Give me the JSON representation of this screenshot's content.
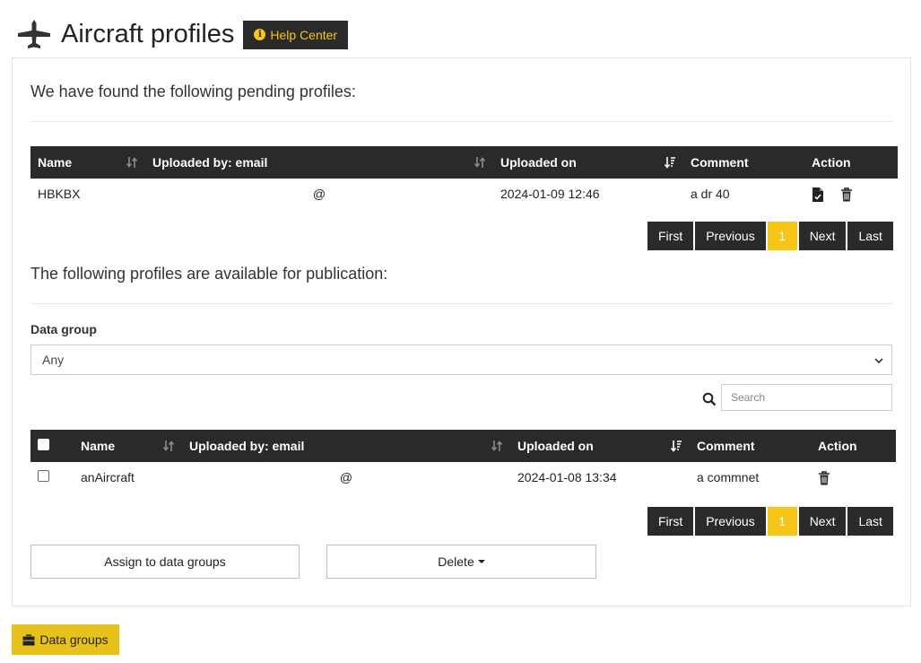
{
  "header": {
    "title": "Aircraft profiles",
    "help_label": "Help Center",
    "plane_icon": "plane-icon",
    "info_icon_glyph": "i"
  },
  "pending": {
    "intro": "We have found the following pending profiles:",
    "columns": [
      "Name",
      "Uploaded by: email",
      "Uploaded on",
      "Comment",
      "Action"
    ],
    "rows": [
      {
        "name": "HBKBX",
        "email": "@",
        "uploaded_on": "2024-01-09 12:46",
        "comment": "a dr 40"
      }
    ],
    "pager": {
      "first": "First",
      "previous": "Previous",
      "page": "1",
      "next": "Next",
      "last": "Last"
    }
  },
  "available": {
    "intro": "The following profiles are available for publication:",
    "data_group_label": "Data group",
    "data_group_value": "Any",
    "search_placeholder": "Search",
    "columns": [
      "Name",
      "Uploaded by: email",
      "Uploaded on",
      "Comment",
      "Action"
    ],
    "rows": [
      {
        "name": "anAircraft",
        "email": "@",
        "uploaded_on": "2024-01-08 13:34",
        "comment": "a commnet"
      }
    ],
    "pager": {
      "first": "First",
      "previous": "Previous",
      "page": "1",
      "next": "Next",
      "last": "Last"
    },
    "assign_label": "Assign to data groups",
    "delete_label": "Delete"
  },
  "footer": {
    "data_groups_label": "Data groups"
  },
  "colors": {
    "accent": "#f5c518",
    "dark": "#2a2a2a"
  }
}
